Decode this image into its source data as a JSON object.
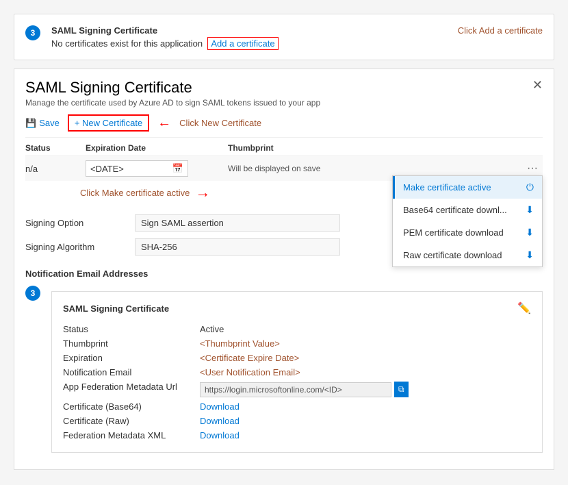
{
  "step3badge": "3",
  "topNotice": {
    "title": "SAML Signing Certificate",
    "text": "No certificates exist for this application",
    "addLinkText": "Add a certificate",
    "hintText": "Click Add a certificate"
  },
  "panel": {
    "title": "SAML Signing Certificate",
    "subtitle": "Manage the certificate used by Azure AD to sign SAML tokens issued to your app",
    "closeLabel": "✕"
  },
  "toolbar": {
    "saveLabel": "Save",
    "newCertLabel": "+ New Certificate",
    "hintText": "Click New Certificate"
  },
  "table": {
    "headers": {
      "status": "Status",
      "expiration": "Expiration Date",
      "thumbprint": "Thumbprint"
    },
    "row": {
      "status": "n/a",
      "date": "<DATE>",
      "thumbprintText": "Will be displayed on save"
    }
  },
  "certActiveHint": "Click Make certificate active",
  "dropdown": {
    "items": [
      {
        "label": "Make certificate active",
        "icon": "power"
      },
      {
        "label": "Base64 certificate downl...",
        "icon": "download"
      },
      {
        "label": "PEM certificate download",
        "icon": "download"
      },
      {
        "label": "Raw certificate download",
        "icon": "download"
      }
    ]
  },
  "form": {
    "signingOptionLabel": "Signing Option",
    "signingOptionValue": "Sign SAML assertion",
    "signingAlgorithmLabel": "Signing Algorithm",
    "signingAlgorithmValue": "SHA-256"
  },
  "notificationSection": {
    "label": "Notification Email Addresses"
  },
  "certBox": {
    "title": "SAML Signing Certificate",
    "fields": [
      {
        "label": "Status",
        "value": "Active",
        "type": "text"
      },
      {
        "label": "Thumbprint",
        "value": "<Thumbprint Value>",
        "type": "placeholder"
      },
      {
        "label": "Expiration",
        "value": "<Certificate Expire Date>",
        "type": "placeholder"
      },
      {
        "label": "Notification Email",
        "value": "<User Notification Email>",
        "type": "placeholder"
      },
      {
        "label": "App Federation Metadata Url",
        "value": "https://login.microsoftonline.com/<ID>",
        "type": "url"
      },
      {
        "label": "Certificate (Base64)",
        "value": "Download",
        "type": "link"
      },
      {
        "label": "Certificate (Raw)",
        "value": "Download",
        "type": "link"
      },
      {
        "label": "Federation Metadata XML",
        "value": "Download",
        "type": "link"
      }
    ]
  }
}
